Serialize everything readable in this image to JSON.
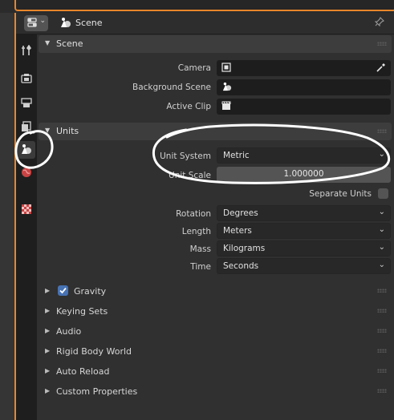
{
  "header": {
    "title": "Scene",
    "editor_icon": "properties-editor-icon",
    "pin_icon": "pin-icon"
  },
  "tabs": [
    {
      "name": "tool",
      "icon": "tool-icon",
      "color": "#c8c8c8"
    },
    {
      "name": "render",
      "icon": "render-icon",
      "color": "#c8c8c8"
    },
    {
      "name": "output",
      "icon": "output-icon",
      "color": "#c8c8c8"
    },
    {
      "name": "view-layer",
      "icon": "view-layer-icon",
      "color": "#c8c8c8"
    },
    {
      "name": "scene",
      "icon": "scene-icon",
      "color": "#ffffff",
      "active": true
    },
    {
      "name": "world",
      "icon": "world-icon",
      "color": "#d24a4a"
    },
    {
      "name": "texture",
      "icon": "texture-icon",
      "color": "#d24a4a"
    }
  ],
  "scene_panel": {
    "title": "Scene",
    "camera_label": "Camera",
    "background_scene_label": "Background Scene",
    "active_clip_label": "Active Clip"
  },
  "units_panel": {
    "title": "Units",
    "unit_system_label": "Unit System",
    "unit_system_value": "Metric",
    "unit_scale_label": "Unit Scale",
    "unit_scale_value": "1.000000",
    "separate_units_label": "Separate Units",
    "separate_units_checked": false,
    "rotation_label": "Rotation",
    "rotation_value": "Degrees",
    "length_label": "Length",
    "length_value": "Meters",
    "mass_label": "Mass",
    "mass_value": "Kilograms",
    "time_label": "Time",
    "time_value": "Seconds"
  },
  "collapsed_panels": {
    "gravity": {
      "label": "Gravity",
      "checked": true
    },
    "keying_sets": "Keying Sets",
    "audio": "Audio",
    "rigid_body_world": "Rigid Body World",
    "auto_reload": "Auto Reload",
    "custom_properties": "Custom Properties"
  },
  "colors": {
    "accent_border": "#e8862a",
    "checkbox_blue": "#4772b3",
    "annotation": "#ffffff"
  }
}
